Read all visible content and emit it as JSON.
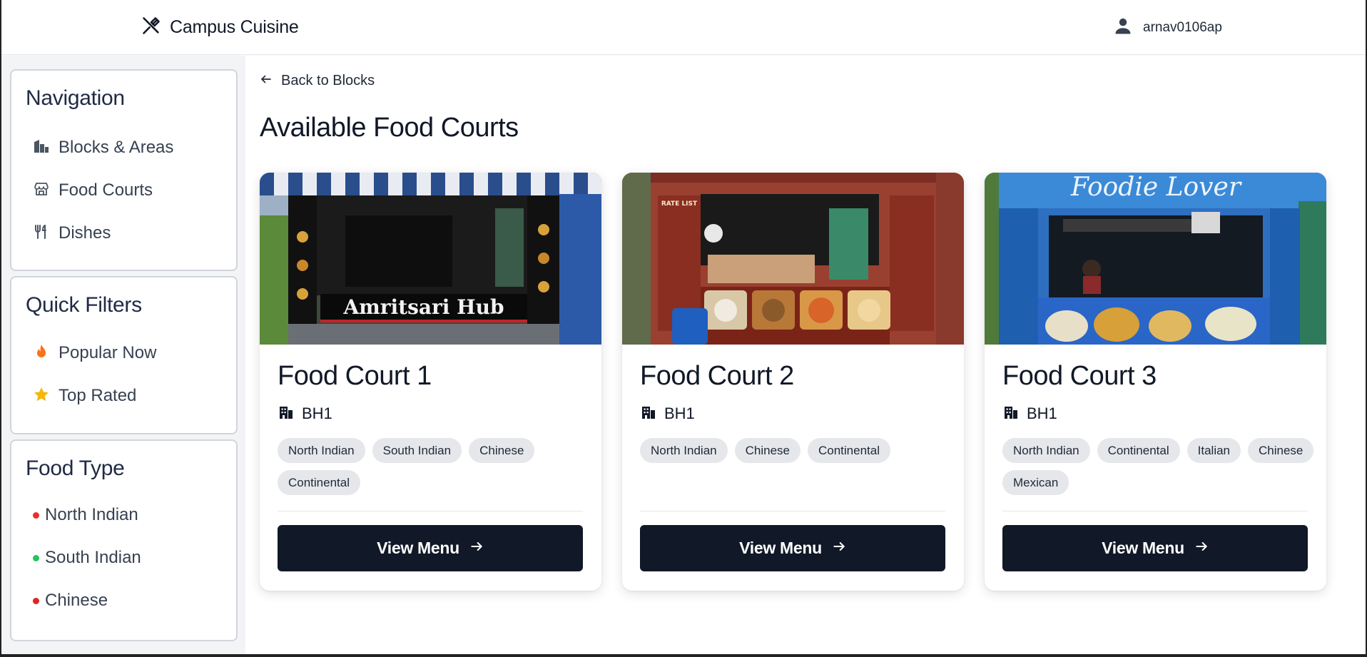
{
  "header": {
    "brand_icon": "utensils-crossed-icon",
    "brand_title": "Campus Cuisine",
    "user_icon": "user-icon",
    "username": "arnav0106ap"
  },
  "sidebar": {
    "navigation": {
      "title": "Navigation",
      "items": [
        {
          "label": "Blocks & Areas",
          "icon": "buildings-icon"
        },
        {
          "label": "Food Courts",
          "icon": "store-icon"
        },
        {
          "label": "Dishes",
          "icon": "utensils-icon"
        }
      ]
    },
    "quick_filters": {
      "title": "Quick Filters",
      "items": [
        {
          "label": "Popular Now",
          "icon": "flame-icon",
          "color": "#f97316"
        },
        {
          "label": "Top Rated",
          "icon": "star-icon",
          "color": "#f5b70a"
        }
      ]
    },
    "food_type": {
      "title": "Food Type",
      "items": [
        {
          "label": "North Indian",
          "color": "#ef2b2b"
        },
        {
          "label": "South Indian",
          "color": "#22c55e"
        },
        {
          "label": "Chinese",
          "color": "#dc2626"
        }
      ]
    }
  },
  "main": {
    "back_label": "Back to Blocks",
    "page_title": "Available Food Courts",
    "view_menu_label": "View Menu",
    "cards": [
      {
        "title": "Food Court 1",
        "block": "BH1",
        "image_sign": "Amritsari Hub",
        "tags": [
          "North Indian",
          "South Indian",
          "Chinese",
          "Continental"
        ]
      },
      {
        "title": "Food Court 2",
        "block": "BH1",
        "image_sign": "RATE LIST",
        "tags": [
          "North Indian",
          "Chinese",
          "Continental"
        ]
      },
      {
        "title": "Food Court 3",
        "block": "BH1",
        "image_sign": "Foodie Lover",
        "tags": [
          "North Indian",
          "Continental",
          "Italian",
          "Chinese",
          "Mexican"
        ]
      }
    ]
  },
  "colors": {
    "button_bg": "#111827",
    "tag_bg": "#e5e7eb",
    "sidebar_bg": "#f3f4f6"
  }
}
